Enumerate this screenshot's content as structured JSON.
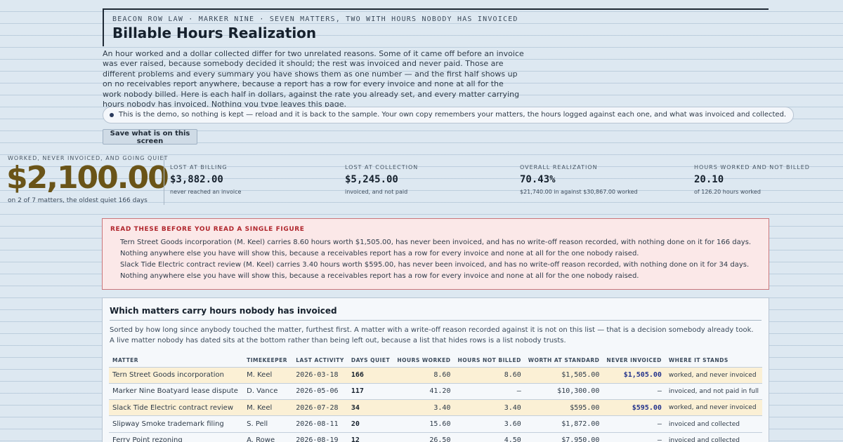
{
  "header": {
    "eyebrow": "BEACON ROW LAW · MARKER NINE · SEVEN MATTERS, TWO WITH HOURS NOBODY HAS INVOICED",
    "title": "Billable Hours Realization"
  },
  "intro": "An hour worked and a dollar collected differ for two unrelated reasons. Some of it came off before an invoice was ever raised, because somebody decided it should; the rest was invoiced and never paid. Those are different problems and every summary you have shows them as one number — and the first half shows up on no receivables report anywhere, because a report has a row for every invoice and none at all for the work nobody billed. Here is each half in dollars, against the rate you already set, and every matter carrying hours nobody has invoiced. Nothing you type leaves this page.",
  "demo_notice": "This is the demo, so nothing is kept — reload and it is back to the sample. Your own copy remembers your matters, the hours logged against each one, and what was invoiced and collected.",
  "save_button": "Save what is on this screen",
  "hero": {
    "label": "WORKED, NEVER INVOICED, AND GOING QUIET",
    "value": "$2,100.00",
    "sub": "on 2 of 7 matters, the oldest quiet 166 days"
  },
  "stats": [
    {
      "label": "LOST AT BILLING",
      "value": "$3,882.00",
      "sub": "never reached an invoice"
    },
    {
      "label": "LOST AT COLLECTION",
      "value": "$5,245.00",
      "sub": "invoiced, and not paid"
    },
    {
      "label": "OVERALL REALIZATION",
      "value": "70.43%",
      "sub": "$21,740.00 in against $30,867.00 worked"
    },
    {
      "label": "HOURS WORKED AND NOT BILLED",
      "value": "20.10",
      "sub": "of 126.20 hours worked"
    }
  ],
  "warning": {
    "heading": "READ THESE BEFORE YOU READ A SINGLE FIGURE",
    "items": [
      "Tern Street Goods incorporation (M. Keel) carries 8.60 hours worth $1,505.00, has never been invoiced, and has no write-off reason recorded, with nothing done on it for 166 days. Nothing anywhere else you have will show this, because a receivables report has a row for every invoice and none at all for the one nobody raised.",
      "Slack Tide Electric contract review (M. Keel) carries 3.40 hours worth $595.00, has never been invoiced, and has no write-off reason recorded, with nothing done on it for 34 days. Nothing anywhere else you have will show this, because a receivables report has a row for every invoice and none at all for the one nobody raised."
    ]
  },
  "panel": {
    "title": "Which matters carry hours nobody has invoiced",
    "description": "Sorted by how long since anybody touched the matter, furthest first. A matter with a write-off reason recorded against it is not on this list — that is a decision somebody already took. A live matter nobody has dated sits at the bottom rather than being left out, because a list that hides rows is a list nobody trusts.",
    "columns": [
      "MATTER",
      "TIMEKEEPER",
      "LAST ACTIVITY",
      "DAYS QUIET",
      "HOURS WORKED",
      "HOURS NOT BILLED",
      "WORTH AT STANDARD",
      "NEVER INVOICED",
      "WHERE IT STANDS"
    ],
    "rows": [
      {
        "matter": "Tern Street Goods incorporation",
        "timekeeper": "M. Keel",
        "last_activity": "2026-03-18",
        "days_quiet": "166",
        "hours_worked": "8.60",
        "hours_not_billed": "8.60",
        "worth": "$1,505.00",
        "never_invoiced": "$1,505.00",
        "where": "worked, and never invoiced",
        "highlight": true
      },
      {
        "matter": "Marker Nine Boatyard lease dispute",
        "timekeeper": "D. Vance",
        "last_activity": "2026-05-06",
        "days_quiet": "117",
        "hours_worked": "41.20",
        "hours_not_billed": "—",
        "worth": "$10,300.00",
        "never_invoiced": "—",
        "where": "invoiced, and not paid in full",
        "highlight": false
      },
      {
        "matter": "Slack Tide Electric contract review",
        "timekeeper": "M. Keel",
        "last_activity": "2026-07-28",
        "days_quiet": "34",
        "hours_worked": "3.40",
        "hours_not_billed": "3.40",
        "worth": "$595.00",
        "never_invoiced": "$595.00",
        "where": "worked, and never invoiced",
        "highlight": true
      },
      {
        "matter": "Slipway Smoke trademark filing",
        "timekeeper": "S. Pell",
        "last_activity": "2026-08-11",
        "days_quiet": "20",
        "hours_worked": "15.60",
        "hours_not_billed": "3.60",
        "worth": "$1,872.00",
        "never_invoiced": "—",
        "where": "invoiced and collected",
        "highlight": false
      },
      {
        "matter": "Ferry Point rezoning",
        "timekeeper": "A. Rowe",
        "last_activity": "2026-08-19",
        "days_quiet": "12",
        "hours_worked": "26.50",
        "hours_not_billed": "4.50",
        "worth": "$7,950.00",
        "never_invoiced": "—",
        "where": "invoiced and collected",
        "highlight": false
      }
    ]
  }
}
